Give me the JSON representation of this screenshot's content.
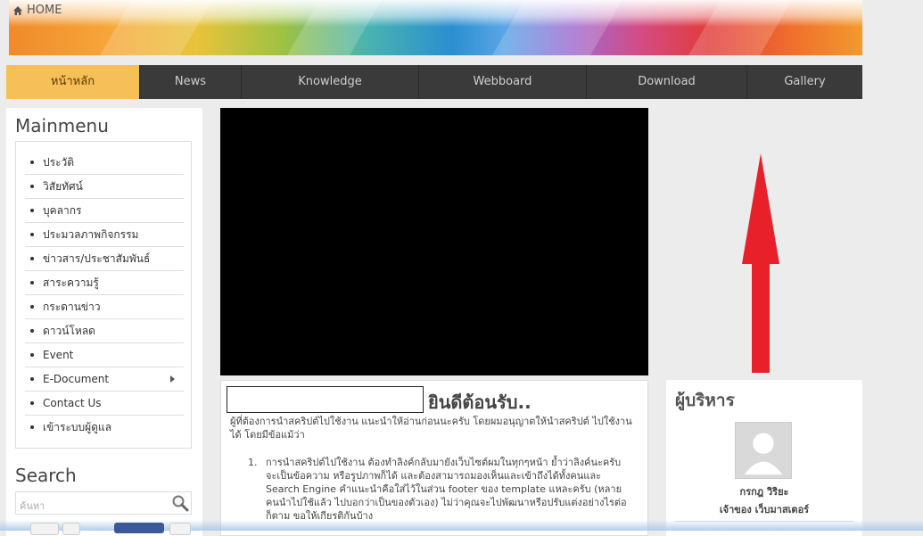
{
  "header": {
    "home_label": "HOME"
  },
  "nav": {
    "items": [
      {
        "label": "หน้าหลัก"
      },
      {
        "label": "News"
      },
      {
        "label": "Knowledge"
      },
      {
        "label": "Webboard"
      },
      {
        "label": "Download"
      },
      {
        "label": "Gallery"
      }
    ]
  },
  "sidebar": {
    "title": "Mainmenu",
    "menu": [
      {
        "label": "ประวัติ"
      },
      {
        "label": "วิสัยทัศน์"
      },
      {
        "label": "บุคลากร"
      },
      {
        "label": "ประมวลภาพกิจกรรม"
      },
      {
        "label": "ข่าวสาร/ประชาสัมพันธ์"
      },
      {
        "label": "สาระความรู้"
      },
      {
        "label": "กระดานข่าว"
      },
      {
        "label": "ดาวน์โหลด"
      },
      {
        "label": "Event"
      },
      {
        "label": "E-Document"
      },
      {
        "label": "Contact Us"
      },
      {
        "label": "เข้าระบบผู้ดูแล"
      }
    ],
    "search_title": "Search",
    "search_placeholder": "ค้นหา"
  },
  "content": {
    "welcome_title": "ยินดีต้อนรับ..",
    "intro": "ผู้ที่ต้องการนำสคริปต์ไปใช้งาน แนะนำให้อ่านก่อนนะครับ โดยผมอนุญาตให้นำสคริปต์ ไปใช้งานได้ โดยมีข้อแม้ว่า",
    "item_number": "1.",
    "item_text": "การนำสคริปต์ไปใช้งาน ต้องทำลิงค์กลับมายังเว็บไซต์ผมในทุกๆหน้า ย้ำว่าลิงค์นะครับ จะเป็นข้อความ หรือรูปภาพก็ได้ และต้องสามารถมองเห็นและเข้าถึงได้ทั้งคนและ Search Engine คำแนะนำคือใส่ไว้ในส่วน footer ของ template แหละครับ (หลายคนนำไปใช้แล้ว ไปบอกว่าเป็นของตัวเอง) ไม่ว่าคุณจะไปพัฒนาหรือปรับแต่งอย่างไรต่อก็ตาม ขอให้เกียรติกันบ้าง"
  },
  "admin": {
    "title": "ผู้บริหาร",
    "name": "กรกฎ วิริยะ",
    "role": "เจ้าของ เว็บมาสเตอร์"
  },
  "colors": {
    "nav_bg": "#3a3a3a",
    "nav_active": "#f7bf58",
    "arrow": "#e8202a"
  }
}
